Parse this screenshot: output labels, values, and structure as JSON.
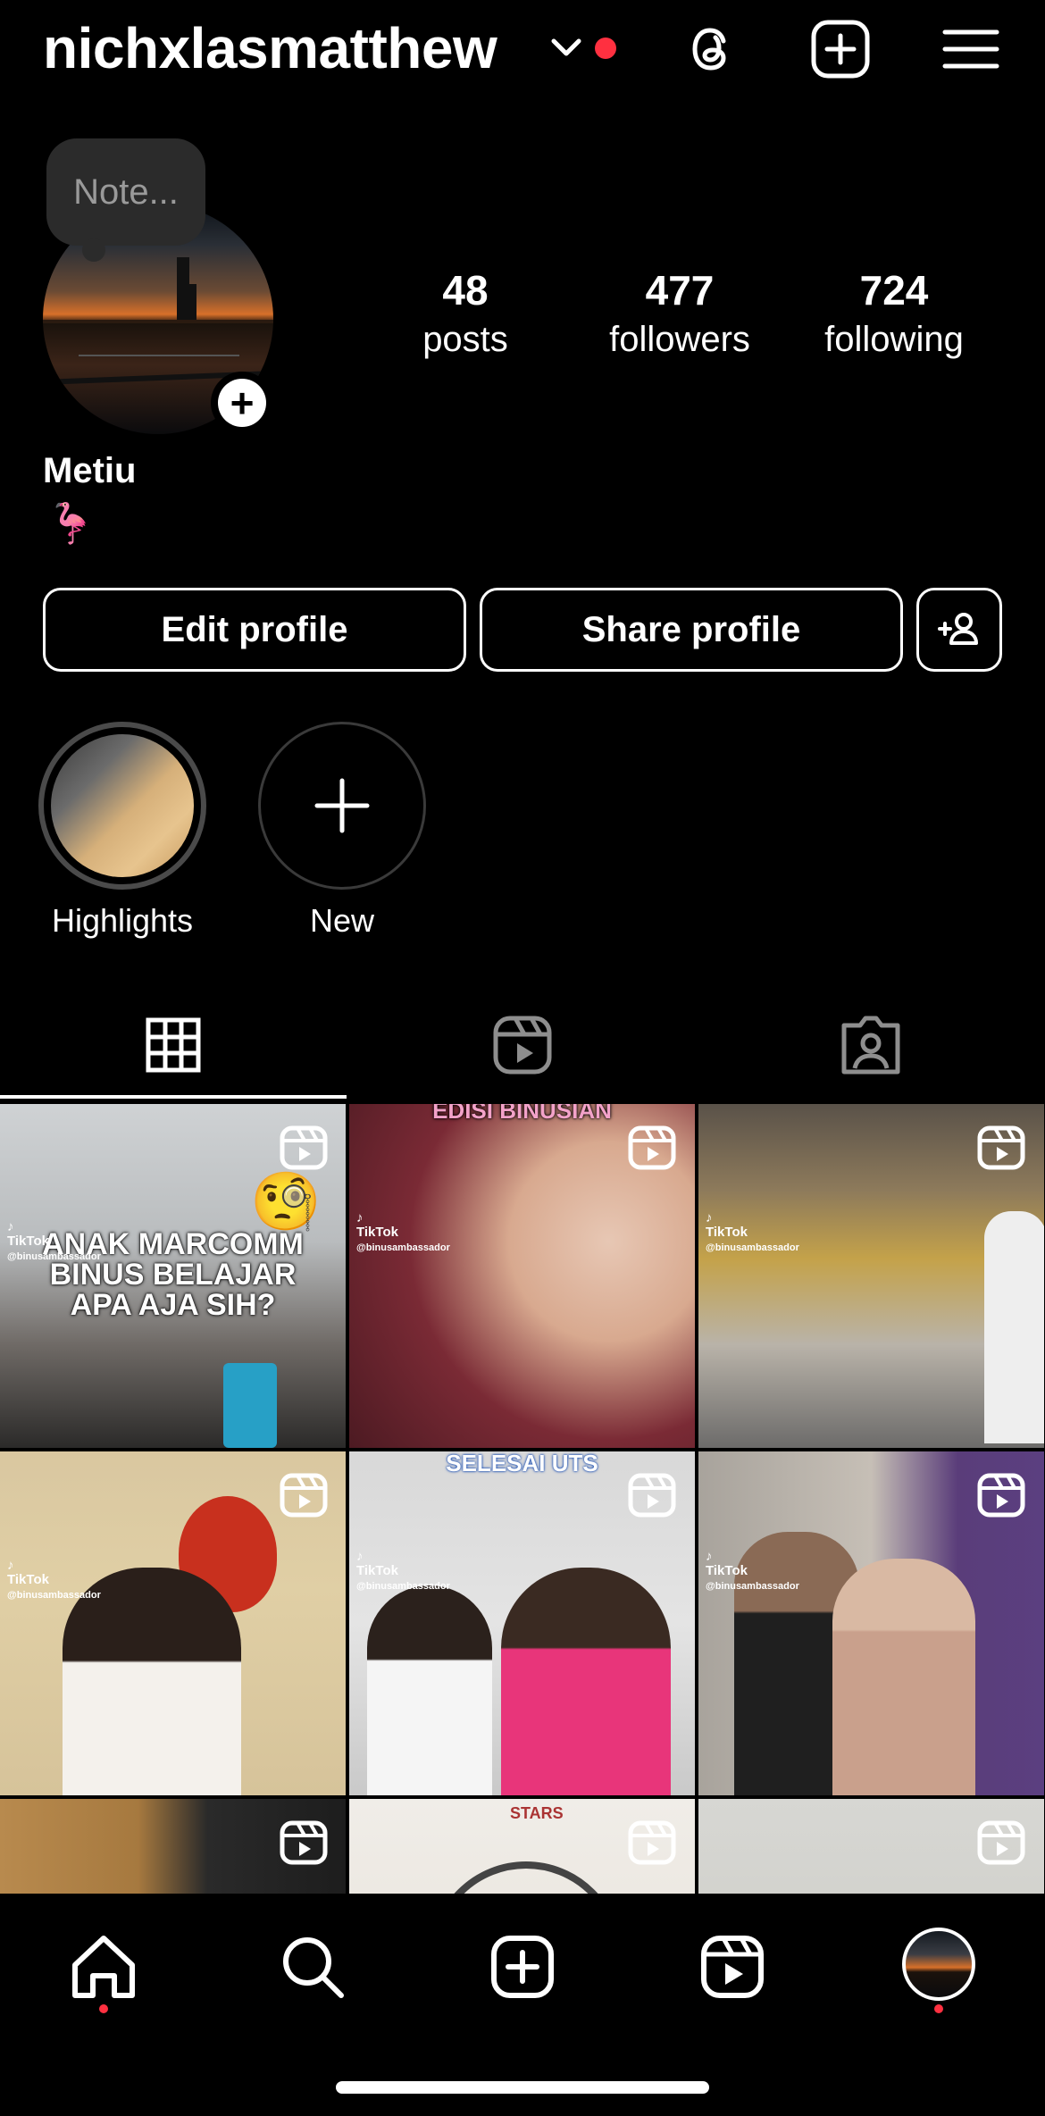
{
  "header": {
    "username": "nichxlasmatthew",
    "chevron_icon": "chevron-down-icon",
    "notification_dot_color": "#ff3040"
  },
  "profile": {
    "note_placeholder": "Note...",
    "display_name": "Metiu",
    "bio": "🦩",
    "stats": [
      {
        "value": "48",
        "label": "posts"
      },
      {
        "value": "477",
        "label": "followers"
      },
      {
        "value": "724",
        "label": "following"
      }
    ]
  },
  "actions": {
    "edit_label": "Edit profile",
    "share_label": "Share profile"
  },
  "highlights": [
    {
      "label": "Highlights"
    },
    {
      "label": "New"
    }
  ],
  "tabs": [
    "grid-icon",
    "reels-icon",
    "tagged-icon"
  ],
  "posts": [
    {
      "caption": "ANAK MARCOMM\nBINUS BELAJAR\nAPA AJA SIH?",
      "handle": "@binusambassador"
    },
    {
      "caption": "EDISI BINUSIAN",
      "handle": "@binusambassador"
    },
    {
      "caption": "",
      "handle": "@binusambassador"
    },
    {
      "caption": "",
      "handle": "@binusambassador"
    },
    {
      "caption": "SELESAI UTS",
      "handle": "@binusambassador"
    },
    {
      "caption": "",
      "handle": "@binusambassador"
    },
    {
      "caption": "",
      "handle": ""
    },
    {
      "caption": "",
      "handle": ""
    },
    {
      "caption": "",
      "handle": ""
    }
  ],
  "watermark": "TikTok",
  "bottom_nav": [
    "home-icon",
    "search-icon",
    "create-icon",
    "reels-icon",
    "profile-avatar"
  ],
  "colors": {
    "background": "#000000",
    "accent_dot": "#ff3040",
    "note_bg": "#2b2b2b"
  }
}
